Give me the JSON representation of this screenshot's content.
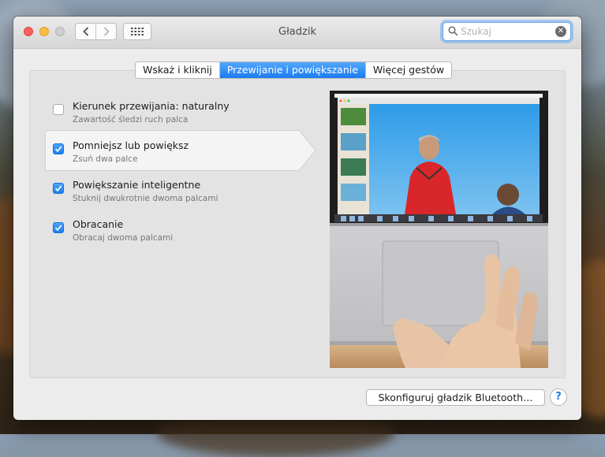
{
  "window": {
    "title": "Gładzik"
  },
  "toolbar": {
    "back_icon": "chevron-left-icon",
    "forward_icon": "chevron-right-icon",
    "grid_icon": "grid-icon"
  },
  "search": {
    "placeholder": "Szukaj",
    "value": ""
  },
  "tabs": [
    {
      "label": "Wskaż i kliknij",
      "active": false
    },
    {
      "label": "Przewijanie i powiększanie",
      "active": true
    },
    {
      "label": "Więcej gestów",
      "active": false
    }
  ],
  "options": [
    {
      "label": "Kierunek przewijania: naturalny",
      "description": "Zawartość śledzi ruch palca",
      "checked": false,
      "selected": false
    },
    {
      "label": "Pomniejsz lub powiększ",
      "description": "Zsuń dwa palce",
      "checked": true,
      "selected": true
    },
    {
      "label": "Powiększanie inteligentne",
      "description": "Stuknij dwukrotnie dwoma palcami",
      "checked": true,
      "selected": false
    },
    {
      "label": "Obracanie",
      "description": "Obracaj dwoma palcami",
      "checked": true,
      "selected": false
    }
  ],
  "preview": {
    "menubar_app": "Preview"
  },
  "footer": {
    "bluetooth_button": "Skonfiguruj gładzik Bluetooth…",
    "help_label": "?"
  },
  "colors": {
    "accent": "#1b7cf2",
    "close": "#fc605c",
    "minimize": "#fdbc40"
  }
}
